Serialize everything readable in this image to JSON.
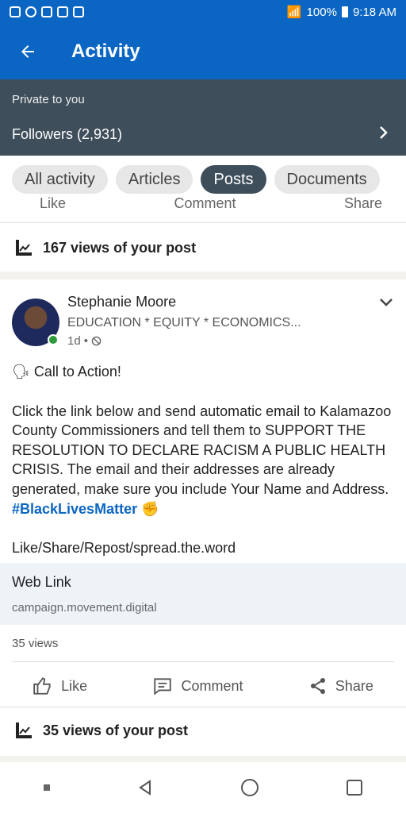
{
  "status_bar": {
    "battery": "100%",
    "time": "9:18 AM"
  },
  "app_bar": {
    "title": "Activity"
  },
  "private_section": {
    "label": "Private to you",
    "followers": "Followers (2,931)"
  },
  "filters": [
    {
      "label": "All activity",
      "active": false
    },
    {
      "label": "Articles",
      "active": false
    },
    {
      "label": "Posts",
      "active": true
    },
    {
      "label": "Documents",
      "active": false
    }
  ],
  "card_prev": {
    "partial_actions": [
      "Like",
      "Comment",
      "Share"
    ],
    "views_text": "167 views of your post"
  },
  "post": {
    "author": "Stephanie Moore",
    "headline": "EDUCATION * EQUITY * ECONOMICS...",
    "time": "1d",
    "call_to_action": "Call to Action!",
    "body": "Click the link below and send automatic email to Kalamazoo County Commissioners and tell them to SUPPORT THE RESOLUTION TO DECLARE RACISM A PUBLIC HEALTH CRISIS. The email and their addresses are already generated, make sure you include Your Name and Address.",
    "hashtag": "#BlackLivesMatter",
    "footer_line": "Like/Share/Repost/spread.the.word",
    "link_title": "Web Link",
    "link_url": "campaign.movement.digital",
    "views": "35 views",
    "actions": {
      "like": "Like",
      "comment": "Comment",
      "share": "Share"
    },
    "views_text": "35 views of your post"
  },
  "colors": {
    "brand": "#0a66c2",
    "dark_slate": "#3e4e5b"
  }
}
